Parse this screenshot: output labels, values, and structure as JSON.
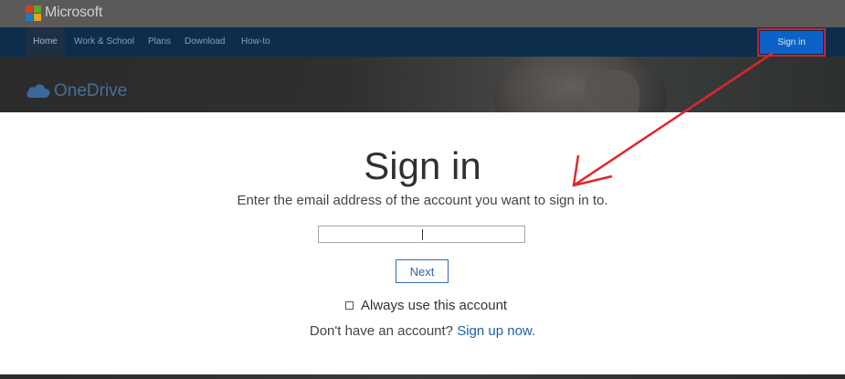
{
  "header": {
    "brand": "Microsoft"
  },
  "nav": {
    "items": [
      {
        "label": "Home",
        "active": true
      },
      {
        "label": "Work & School"
      },
      {
        "label": "Plans"
      },
      {
        "label": "Download"
      },
      {
        "label": "How-to"
      }
    ],
    "signin_label": "Sign in"
  },
  "hero": {
    "product": "OneDrive"
  },
  "modal": {
    "title": "Sign in",
    "subtitle": "Enter the email address of the account you want to sign in to.",
    "email_value": "",
    "next_label": "Next",
    "always_label": "Always use this account",
    "always_checked": false,
    "signup_prompt": "Don't have an account?",
    "signup_link": "Sign up now."
  },
  "annotation": {
    "color": "#e0262b"
  },
  "colors": {
    "nav_bg": "#0c2e4c",
    "signin_bg": "#0b63c7",
    "link": "#1f5ea8"
  }
}
